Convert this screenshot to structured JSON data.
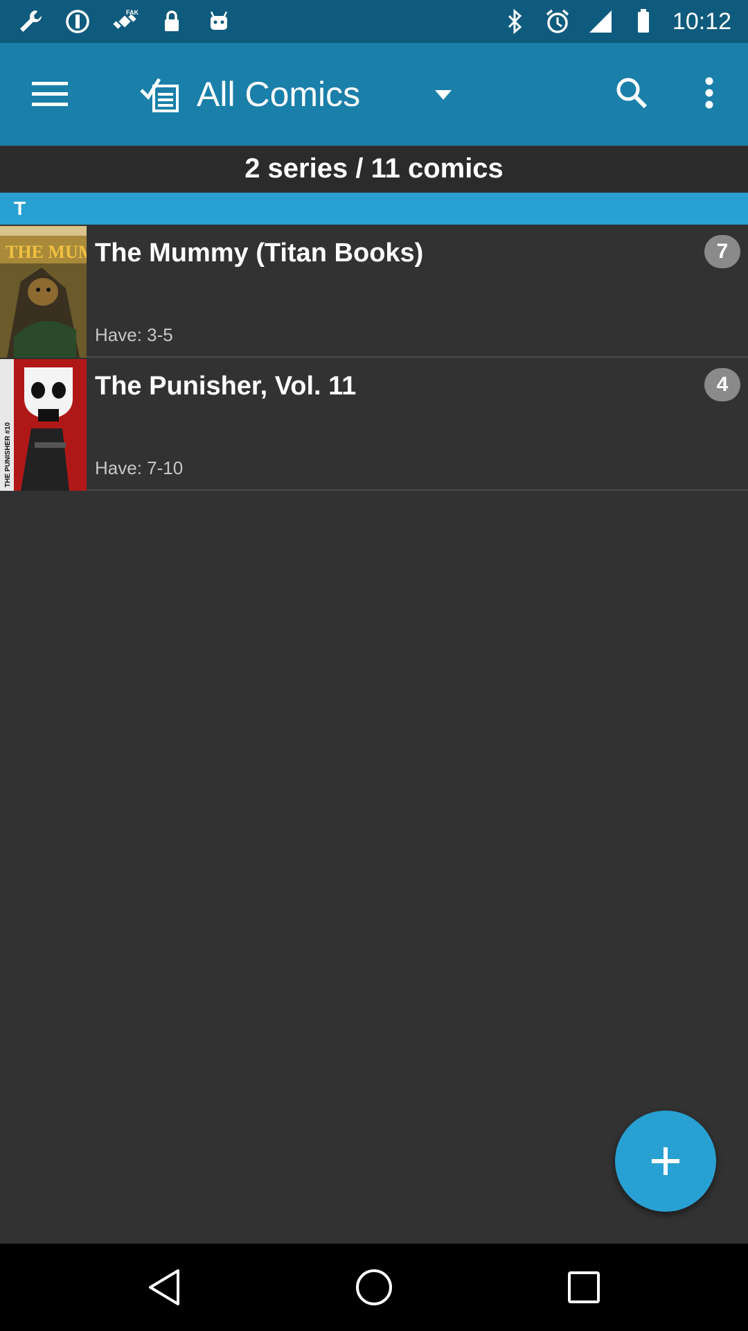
{
  "status_bar": {
    "time": "10:12",
    "left_icons": [
      "wrench-icon",
      "data-saver-icon",
      "fake-gps-icon",
      "lock-icon",
      "android-icon"
    ],
    "right_icons": [
      "bluetooth-icon",
      "alarm-icon",
      "signal-icon",
      "battery-icon"
    ]
  },
  "app_bar": {
    "title": "All Comics",
    "background": "#1a7fa9"
  },
  "summary": {
    "text": "2 series / 11 comics"
  },
  "section": {
    "letter": "T",
    "color": "#29a0d2"
  },
  "series": [
    {
      "title": "The Mummy (Titan Books)",
      "have": "Have: 3-5",
      "count": "7",
      "cover_text": "THE MUMMY"
    },
    {
      "title": "The Punisher, Vol. 11",
      "have": "Have: 7-10",
      "count": "4",
      "cover_text": "THE PUNISHER #10"
    }
  ],
  "fab": {
    "icon": "plus-icon"
  },
  "nav": {
    "back": "back-icon",
    "home": "home-icon",
    "recents": "recents-icon"
  }
}
